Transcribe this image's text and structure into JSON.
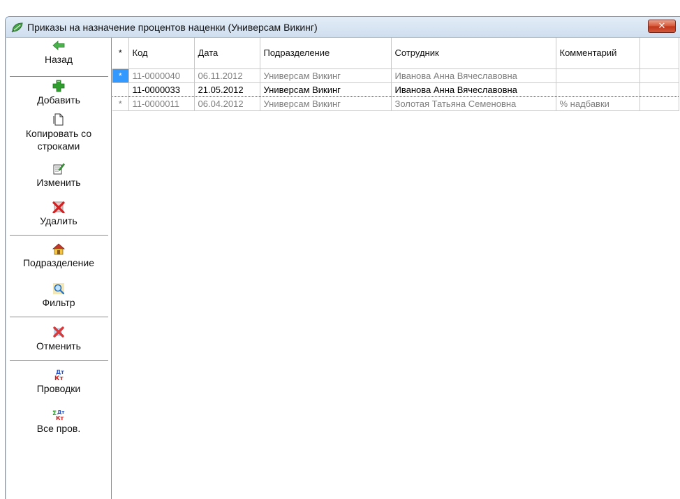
{
  "window": {
    "title": "Приказы на назначение процентов наценки (Универсам Викинг)",
    "close_label": "✕"
  },
  "toolbar": {
    "back": "Назад",
    "add": "Добавить",
    "copy_line1": "Копировать со",
    "copy_line2": "строками",
    "edit": "Изменить",
    "delete": "Удалить",
    "division": "Подразделение",
    "filter": "Фильтр",
    "cancel": "Отменить",
    "postings": "Проводки",
    "all_postings": "Все пров."
  },
  "table": {
    "columns": {
      "marker": "*",
      "code": "Код",
      "date": "Дата",
      "division": "Подразделение",
      "employee": "Сотрудник",
      "comment": "Комментарий"
    },
    "rows": [
      {
        "marker": "*",
        "code": "11-0000040",
        "date": "06.11.2012",
        "division": "Универсам Викинг",
        "employee": "Иванова Анна Вячеславовна",
        "comment": ""
      },
      {
        "marker": "",
        "code": "11-0000033",
        "date": "21.05.2012",
        "division": "Универсам Викинг",
        "employee": "Иванова Анна Вячеславовна",
        "comment": ""
      },
      {
        "marker": "*",
        "code": "11-0000011",
        "date": "06.04.2012",
        "division": "Универсам Викинг",
        "employee": "Золотая Татьяна Семеновна",
        "comment": "% надбавки"
      }
    ]
  },
  "icons": {
    "app": "leaf-icon",
    "back": "arrow-left-icon",
    "add": "plus-icon",
    "copy": "copy-document-icon",
    "edit": "edit-note-icon",
    "delete": "delete-x-icon",
    "division": "house-icon",
    "filter": "magnifier-icon",
    "cancel": "cancel-x-icon",
    "postings": "debit-credit-icon",
    "all_postings": "sum-debit-credit-icon"
  },
  "colors": {
    "accent": "#3399ff",
    "add_green": "#2f9e2f",
    "delete_red": "#d32020"
  }
}
